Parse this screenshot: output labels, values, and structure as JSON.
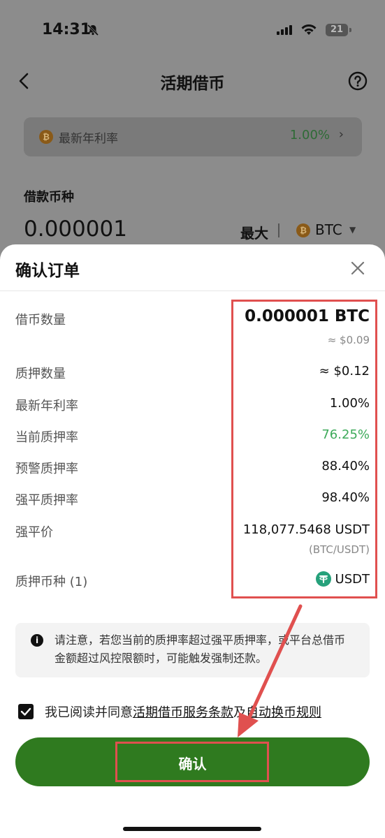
{
  "status_bar": {
    "time": "14:31",
    "battery": "21"
  },
  "header": {
    "title": "活期借币"
  },
  "rate_bar": {
    "label": "最新年利率",
    "value": "1.00%"
  },
  "borrow": {
    "label": "借款币种",
    "amount": "0.000001",
    "max_label": "最大",
    "coin": "BTC"
  },
  "sheet": {
    "title": "确认订单",
    "rows": [
      {
        "label": "借币数量",
        "value": "0.000001 BTC",
        "sub": "≈ $0.09"
      },
      {
        "label": "质押数量",
        "value": "≈ $0.12"
      },
      {
        "label": "最新年利率",
        "value": "1.00%"
      },
      {
        "label": "当前质押率",
        "value": "76.25%"
      },
      {
        "label": "预警质押率",
        "value": "88.40%"
      },
      {
        "label": "强平质押率",
        "value": "98.40%"
      },
      {
        "label": "强平价",
        "value": "118,077.5468 USDT",
        "sub": "(BTC/USDT)"
      },
      {
        "label": "质押币种 (1)",
        "value": "USDT"
      }
    ],
    "notice": "请注意，若您当前的质押率超过强平质押率，或平台总借币金额超过风控限额时，可能触发强制还款。",
    "agree": {
      "prefix": "我已阅读并同意",
      "link1": "活期借币服务条款",
      "middle": "及",
      "link2": "自动换币规则"
    },
    "confirm_label": "确认"
  },
  "colors": {
    "accent": "#2f7a1f",
    "highlight": "#e0504f",
    "positive": "#3daa5a"
  }
}
